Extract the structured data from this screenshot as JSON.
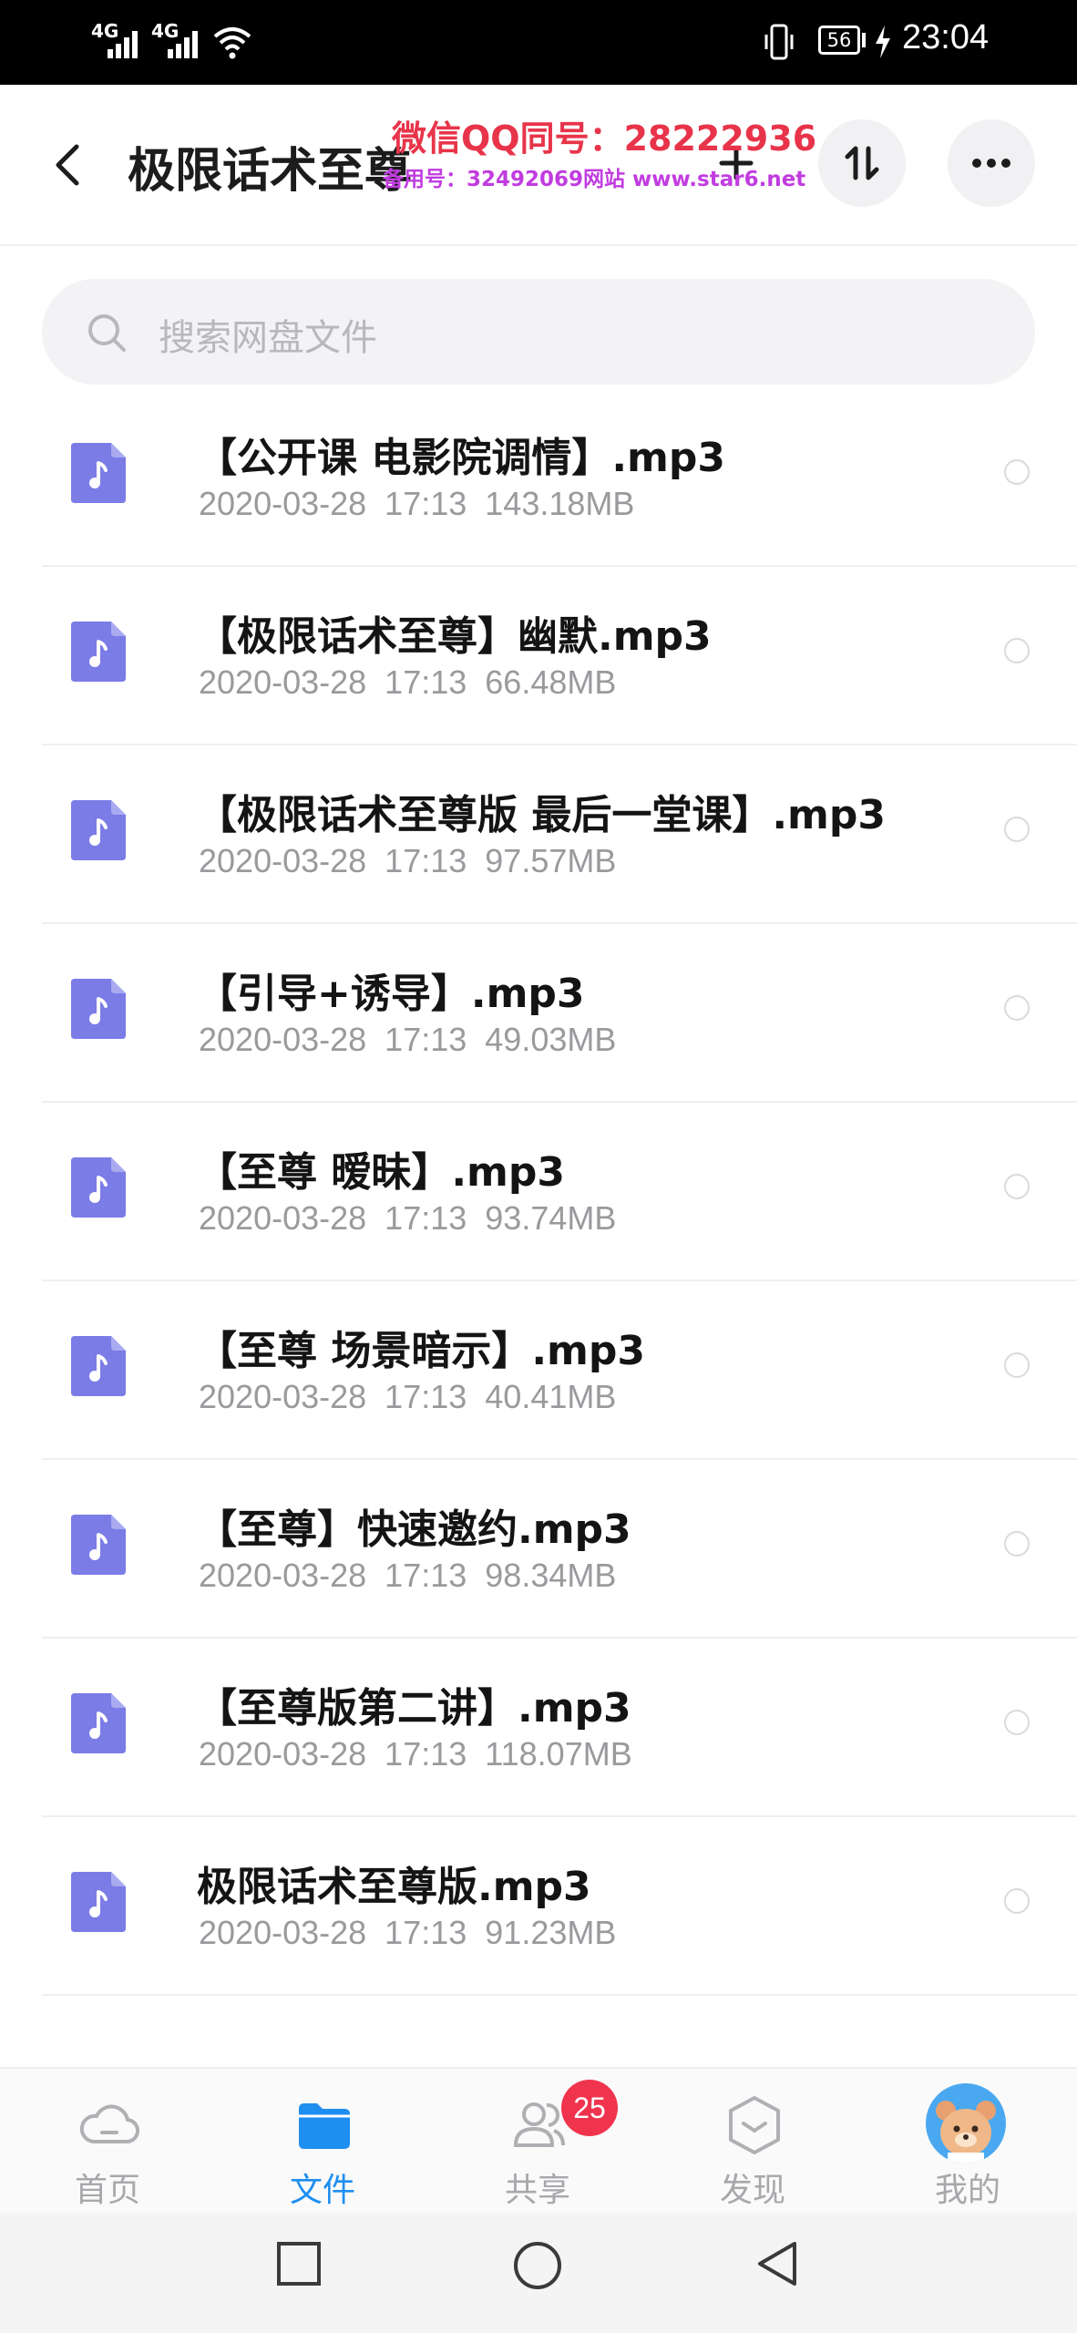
{
  "status_bar": {
    "sim1": "4G",
    "sim2": "4G",
    "battery": "56",
    "time": "23:04"
  },
  "header": {
    "title": "极限话术至尊",
    "watermark_line1": "微信QQ同号：28222936",
    "watermark_line2": "备用号：32492069网站 www.star6.net",
    "add_icon": "plus-icon",
    "sort_icon": "sort-icon",
    "more_icon": "more-icon"
  },
  "search": {
    "placeholder": "搜索网盘文件"
  },
  "files": [
    {
      "name": "【公开课 电影院调情】.mp3",
      "date": "2020-03-28",
      "time": "17:13",
      "size": "143.18MB"
    },
    {
      "name": "【极限话术至尊】幽默.mp3",
      "date": "2020-03-28",
      "time": "17:13",
      "size": "66.48MB"
    },
    {
      "name": "【极限话术至尊版 最后一堂课】.mp3",
      "date": "2020-03-28",
      "time": "17:13",
      "size": "97.57MB"
    },
    {
      "name": "【引导+诱导】.mp3",
      "date": "2020-03-28",
      "time": "17:13",
      "size": "49.03MB"
    },
    {
      "name": "【至尊 暧昧】.mp3",
      "date": "2020-03-28",
      "time": "17:13",
      "size": "93.74MB"
    },
    {
      "name": "【至尊 场景暗示】.mp3",
      "date": "2020-03-28",
      "time": "17:13",
      "size": "40.41MB"
    },
    {
      "name": "【至尊】快速邀约.mp3",
      "date": "2020-03-28",
      "time": "17:13",
      "size": "98.34MB"
    },
    {
      "name": "【至尊版第二讲】.mp3",
      "date": "2020-03-28",
      "time": "17:13",
      "size": "118.07MB"
    },
    {
      "name": "极限话术至尊版.mp3",
      "date": "2020-03-28",
      "time": "17:13",
      "size": "91.23MB"
    }
  ],
  "tabs": [
    {
      "label": "首页",
      "icon": "cloud-icon",
      "active": false
    },
    {
      "label": "文件",
      "icon": "folder-icon",
      "active": true
    },
    {
      "label": "共享",
      "icon": "users-icon",
      "active": false
    },
    {
      "label": "发现",
      "icon": "discover-icon",
      "active": false
    },
    {
      "label": "我的",
      "icon": "avatar",
      "active": false
    }
  ],
  "share_badge": "25",
  "colors": {
    "accent": "#1e8ef0",
    "file_icon": "#7b7ce6",
    "badge": "#f0344d",
    "watermark": "#e8344a"
  }
}
